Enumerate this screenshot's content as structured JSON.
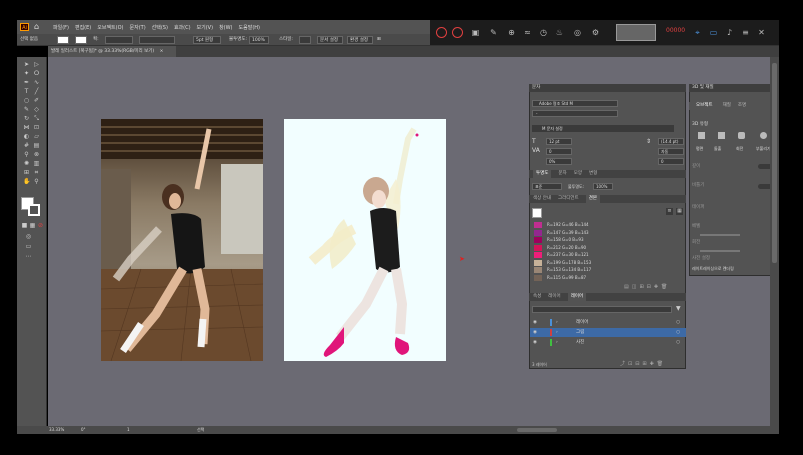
{
  "menubar": {
    "logo_text": "Ai",
    "items": [
      "파일(F)",
      "편집(E)",
      "오브젝트(O)",
      "문자(T)",
      "선택(S)",
      "효과(C)",
      "보기(V)",
      "창(W)",
      "도움말(H)"
    ]
  },
  "control_bar": {
    "selection_label": "선택 없음",
    "stroke_label": "획:",
    "brush_value": "5pt 원형",
    "opacity_label": "불투명도:",
    "opacity_value": "100%",
    "style_label": "스타일:",
    "doc_setup_button": "문서 설정",
    "preferences_button": "환경 설정"
  },
  "recorder": {
    "time_text": "00000"
  },
  "document_tab": {
    "title": "발레 일러스트 [복구됨]* @ 33.33%(RGB/미리 보기)",
    "close": "×"
  },
  "character_panel": {
    "title": "문자",
    "search_placeholder": "문자 검색",
    "font_name": "Adobe 명조 Std M",
    "font_style": "-",
    "preset_label": "M 문자 설정",
    "size_value": "12 pt",
    "leading_value": "(14.4 pt)",
    "tracking_value": "0",
    "kerning_value": "자동",
    "scale_value": "0%",
    "baseline_value": "0"
  },
  "transparency_tabs": [
    "투명도",
    "문자",
    "모양",
    "변형"
  ],
  "transparency": {
    "blend_mode": "표준",
    "opacity_label": "불투명도:",
    "opacity_value": "100%"
  },
  "swatches_tabs": [
    "색상 안내",
    "그라디언트",
    "견본"
  ],
  "swatches": [
    {
      "label": "R=192 G=46 B=144",
      "color": "#c02e90"
    },
    {
      "label": "R=147 G=39 B=143",
      "color": "#93278f"
    },
    {
      "label": "R=158 G=0 B=93",
      "color": "#9e005d"
    },
    {
      "label": "R=212 G=20 B=90",
      "color": "#d4145a"
    },
    {
      "label": "R=237 G=30 B=121",
      "color": "#ed1e79"
    },
    {
      "label": "R=199 G=178 B=153",
      "color": "#c7b299"
    },
    {
      "label": "R=153 G=134 B=117",
      "color": "#998675"
    },
    {
      "label": "R=115 G=99 B=87",
      "color": "#736357"
    }
  ],
  "layers_tabs": [
    "속성",
    "레이어",
    "레이어"
  ],
  "layers": [
    {
      "name": "레이어",
      "selected": false,
      "color": "#4a90d9"
    },
    {
      "name": "그림",
      "selected": true,
      "color": "#d04040"
    },
    {
      "name": "사진",
      "selected": false,
      "color": "#40c040"
    }
  ],
  "layers_footer": "3 레이어",
  "properties_3d": {
    "title": "3D 및 재질",
    "tabs": [
      "오브젝트",
      "재질",
      "조명"
    ],
    "section_type": "3D 유형",
    "buttons": [
      "평면",
      "돌출",
      "회전",
      "부풀리기"
    ],
    "depth_label": "깊이",
    "twist_label": "비틀기",
    "taper_label": "테이퍼",
    "bevel_label": "베벨",
    "rotation_label": "회전",
    "preset_label": "사전 설정",
    "render_label": "레이트레이싱으로 렌더링"
  },
  "status": {
    "zoom": "33.33%",
    "rotation": "0°",
    "artboard_nav": "1",
    "tool_name": "선택"
  },
  "colors": {
    "canvas": "#6b6a73",
    "panel": "#535353",
    "selected_layer": "#3d6aa6",
    "shoe_pink": "#e0157a"
  }
}
